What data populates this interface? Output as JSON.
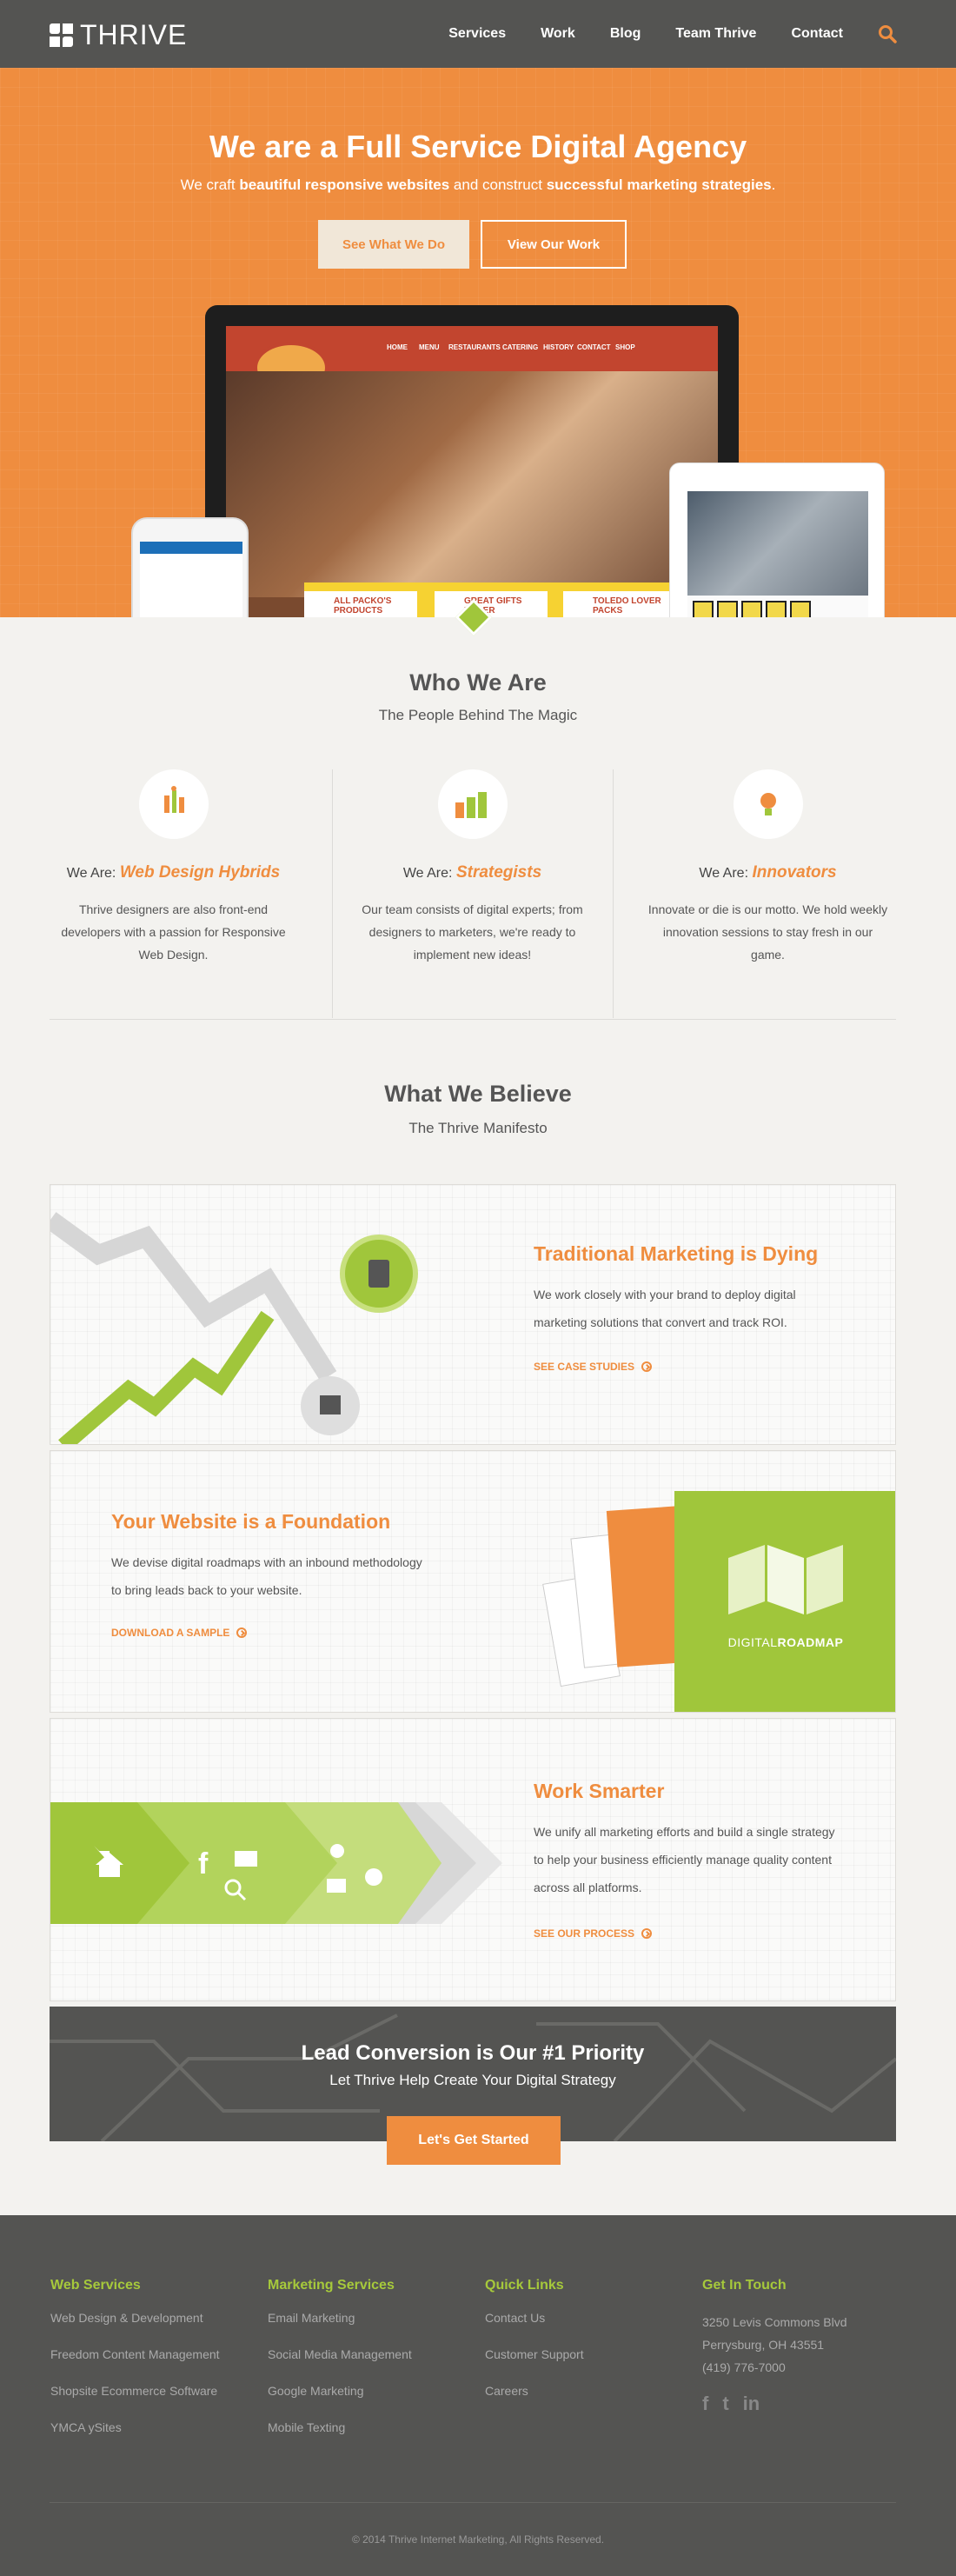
{
  "header": {
    "logo_text": "THRIVE",
    "nav": [
      "Services",
      "Work",
      "Blog",
      "Team Thrive",
      "Contact"
    ],
    "search_icon": "search-icon"
  },
  "hero": {
    "title": "We are a Full Service Digital Agency",
    "subtitle_pre": "We craft ",
    "subtitle_b1": "beautiful responsive websites",
    "subtitle_mid": " and construct ",
    "subtitle_b2": "successful marketing strategies",
    "subtitle_end": ".",
    "button_primary": "See What We Do",
    "button_secondary": "View Our Work",
    "mockup": {
      "nav": [
        "HOME",
        "MENU",
        "RESTAURANTS",
        "CATERING",
        "HISTORY",
        "CONTACT",
        "SHOP"
      ],
      "strip": [
        "ALL PACKO'S PRODUCTS",
        "GREAT GIFTS UNDER",
        "TOLEDO LOVER PACKS"
      ]
    }
  },
  "who": {
    "title": "Who We Are",
    "subtitle": "The People Behind The Magic",
    "prefix": "We Are:",
    "items": [
      {
        "role": "Web Design Hybrids",
        "text": "Thrive designers are also front-end developers with a passion for Responsive Web Design.",
        "icon": "design-tools-icon"
      },
      {
        "role": "Strategists",
        "text": "Our team consists of digital experts; from designers to marketers, we're ready to implement new ideas!",
        "icon": "bar-chart-icon"
      },
      {
        "role": "Innovators",
        "text": "Innovate or die is our motto. We hold weekly innovation sessions to stay fresh in our game.",
        "icon": "lightbulb-icon"
      }
    ]
  },
  "believe": {
    "title": "What We Believe",
    "subtitle": "The Thrive Manifesto",
    "cards": [
      {
        "title": "Traditional Marketing is Dying",
        "text": "We work closely with your brand to deploy digital marketing solutions that convert and track ROI.",
        "link": "SEE CASE STUDIES"
      },
      {
        "title": "Your Website is a Foundation",
        "text": "We devise digital roadmaps with an inbound methodology to bring leads back to your website.",
        "link": "DOWNLOAD A SAMPLE",
        "badge_1": "DIGITAL",
        "badge_2": "ROADMAP"
      },
      {
        "title": "Work Smarter",
        "text": "We unify all marketing efforts and build a single strategy to help your business efficiently manage quality content across all platforms.",
        "link": "SEE OUR PROCESS"
      }
    ]
  },
  "cta": {
    "title": "Lead Conversion is Our #1 Priority",
    "subtitle": "Let Thrive Help Create Your Digital Strategy",
    "button": "Let's Get Started"
  },
  "footer": {
    "columns": [
      {
        "title": "Web Services",
        "links": [
          "Web Design & Development",
          "Freedom Content Management",
          "Shopsite Ecommerce Software",
          "YMCA ySites"
        ]
      },
      {
        "title": "Marketing Services",
        "links": [
          "Email Marketing",
          "Social Media Management",
          "Google Marketing",
          "Mobile Texting"
        ]
      },
      {
        "title": "Quick Links",
        "links": [
          "Contact Us",
          "Customer Support",
          "Careers"
        ]
      }
    ],
    "contact": {
      "title": "Get In Touch",
      "street": "3250 Levis Commons Blvd",
      "city": "Perrysburg, OH 43551",
      "phone": "(419) 776-7000"
    },
    "socials": [
      "f",
      "t",
      "in"
    ],
    "copyright": "© 2014 Thrive Internet Marketing, All Rights Reserved."
  },
  "colors": {
    "orange": "#ef8d3f",
    "green": "#a0c63b",
    "dark": "#545452",
    "bg": "#f3f2ef"
  }
}
